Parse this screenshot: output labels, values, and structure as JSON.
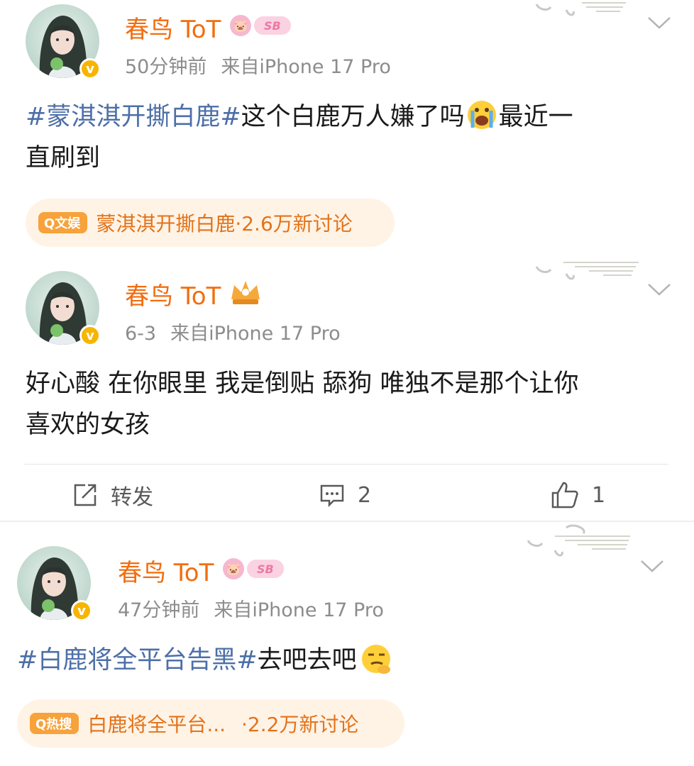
{
  "posts": [
    {
      "username": "春鸟 ToT",
      "level_badge": "SB",
      "time": "50分钟前",
      "source": "来自iPhone 17 Pro",
      "content_tag": "#蒙淇淇开撕白鹿#",
      "content_line1": "这个白鹿万人嫌了吗",
      "content_line1_end": "最近一",
      "content_line2": "直刷到",
      "emoji_name": "crying-face-emoji",
      "topic": {
        "badge": "Q文娱",
        "title": "蒙淇淇开撕白鹿",
        "count": "·2.6万新讨论"
      }
    },
    {
      "username": "春鸟 ToT",
      "time": "6-3",
      "source": "来自iPhone 17 Pro",
      "content_line1": "好心酸 在你眼里 我是倒贴 舔狗 唯独不是那个让你",
      "content_line2": "喜欢的女孩",
      "actions": {
        "repost_label": "转发",
        "comment_count": "2",
        "like_count": "1"
      }
    },
    {
      "username": "春鸟 ToT",
      "level_badge": "SB",
      "time": "47分钟前",
      "source": "来自iPhone 17 Pro",
      "content_tag": "#白鹿将全平台告黑#",
      "content_line1": "去吧去吧",
      "emoji_name": "smirk-face-emoji",
      "topic": {
        "badge": "Q热搜",
        "title": "白鹿将全平台...",
        "count": "·2.2万新讨论"
      }
    }
  ],
  "colors": {
    "username": "#f26d0f",
    "hashtag": "#4d6fa8",
    "topic_bg": "#fff3e6",
    "topic_text": "#e2731a",
    "verified": "#f7b500"
  }
}
